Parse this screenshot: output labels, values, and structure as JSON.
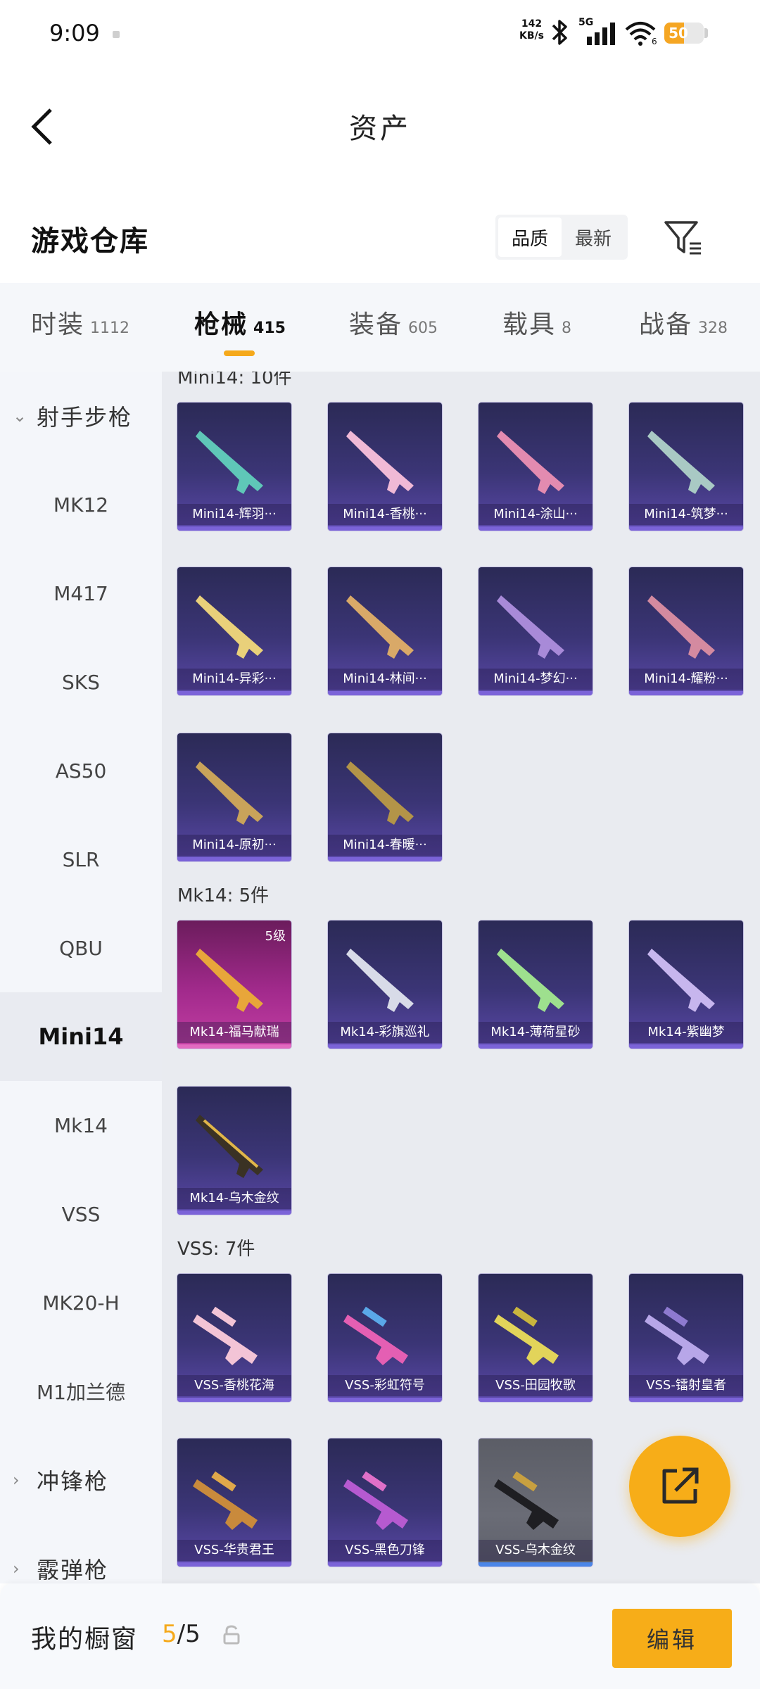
{
  "status_bar": {
    "time": "9:09",
    "net_speed": "142",
    "net_unit": "KB/s",
    "network": "5G",
    "wifi_level": "6",
    "battery": "50"
  },
  "header": {
    "title": "资产",
    "back_icon": "chevron-left-icon"
  },
  "warehouse": {
    "title": "游戏仓库",
    "sort_options": [
      "品质",
      "最新"
    ],
    "sort_selected": "品质",
    "filter_icon": "filter-icon"
  },
  "tabs": [
    {
      "label": "时装",
      "count": "1112"
    },
    {
      "label": "枪械",
      "count": "415"
    },
    {
      "label": "装备",
      "count": "605"
    },
    {
      "label": "载具",
      "count": "8"
    },
    {
      "label": "战备",
      "count": "328"
    }
  ],
  "active_tab": "枪械",
  "sidebar": {
    "group_open": "射手步枪",
    "items": [
      "MK12",
      "M417",
      "SKS",
      "AS50",
      "SLR",
      "QBU",
      "Mini14",
      "Mk14",
      "VSS",
      "MK20-H",
      "M1加兰德"
    ],
    "active_item": "Mini14",
    "groups_collapsed": [
      "冲锋枪",
      "霰弹枪"
    ]
  },
  "sections": [
    {
      "label": "Mini14: 10件",
      "items": [
        "Mini14-辉羽···",
        "Mini14-香桃···",
        "Mini14-涂山···",
        "Mini14-筑梦···",
        "Mini14-异彩···",
        "Mini14-林间···",
        "Mini14-梦幻···",
        "Mini14-耀粉···",
        "Mini14-原初···",
        "Mini14-春暖···"
      ]
    },
    {
      "label": "Mk14: 5件",
      "items": [
        "Mk14-福马献瑞",
        "Mk14-彩旗巡礼",
        "Mk14-薄荷星砂",
        "Mk14-紫幽梦",
        "Mk14-乌木金纹"
      ],
      "first_badge": "5级"
    },
    {
      "label": "VSS: 7件",
      "items": [
        "VSS-香桃花海",
        "VSS-彩虹符号",
        "VSS-田园牧歌",
        "VSS-镭射皇者",
        "VSS-华贵君王",
        "VSS-黑色刀锋",
        "VSS-乌木金纹"
      ]
    }
  ],
  "fab_icon": "share-export-icon",
  "bottom_bar": {
    "label": "我的橱窗",
    "count_current": "5",
    "count_total": "/5",
    "lock_icon": "lock-icon",
    "edit_label": "编辑"
  },
  "colors": {
    "accent": "#f7ad18",
    "card_purple": "#3b3576",
    "card_pink": "#a22a8c",
    "card_gray": "#6a6c76"
  }
}
